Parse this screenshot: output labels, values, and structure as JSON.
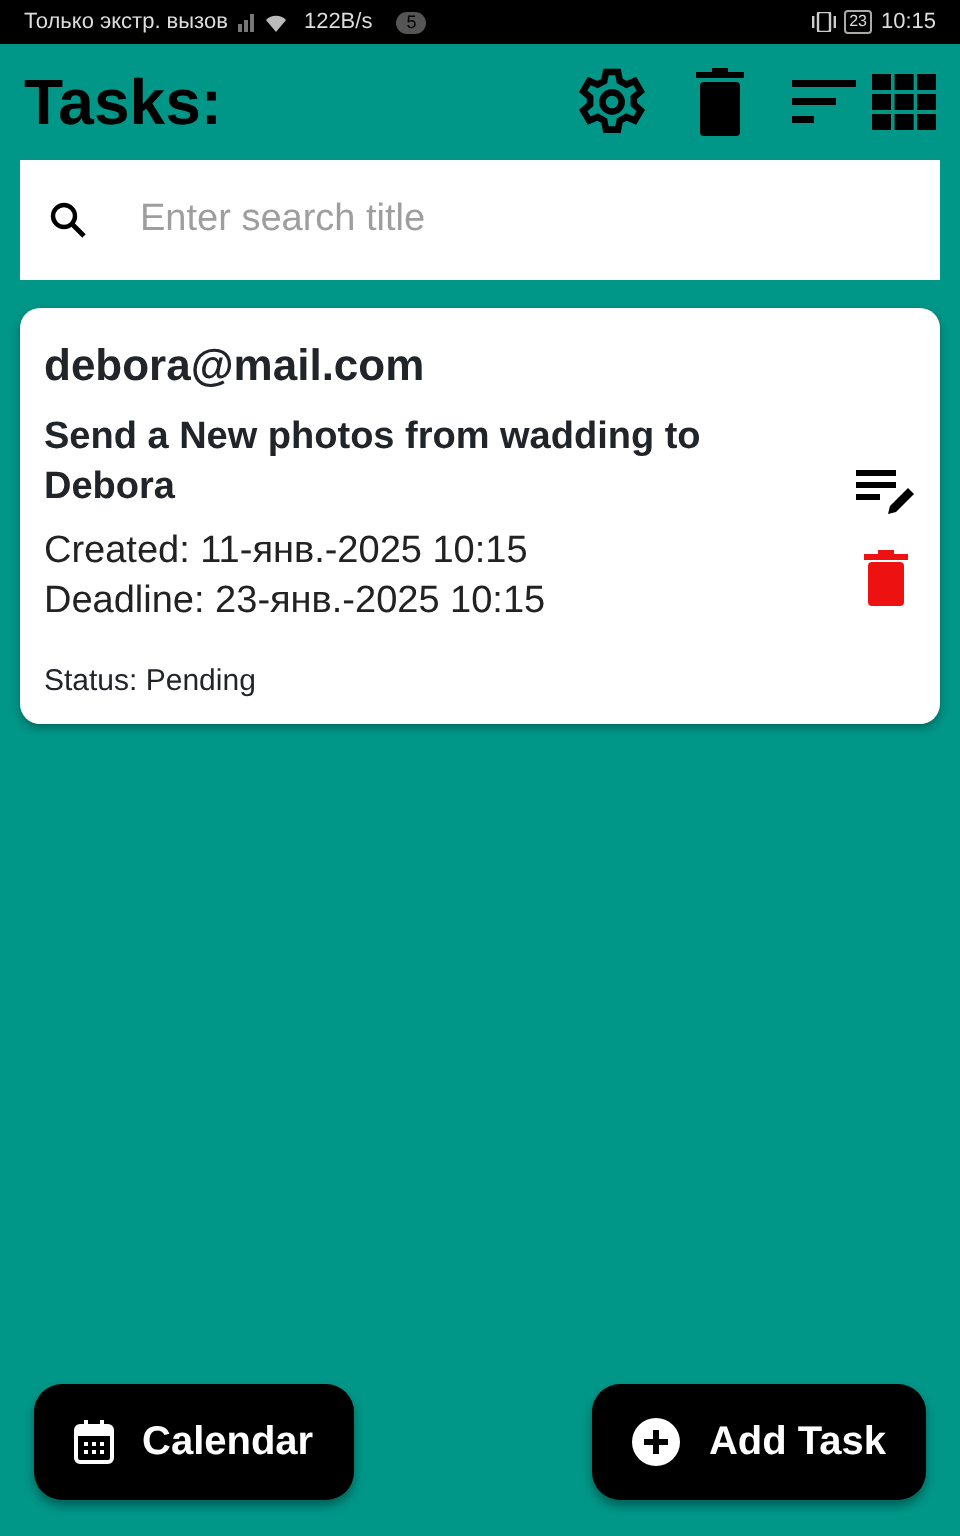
{
  "status_bar": {
    "carrier": "Только экстр. вызов",
    "speed": "122B/s",
    "notification_count": "5",
    "battery": "23",
    "time": "10:15"
  },
  "header": {
    "title": "Tasks:"
  },
  "search": {
    "placeholder": "Enter search title"
  },
  "tasks": [
    {
      "email": "debora@mail.com",
      "title": "Send a New photos from wadding to Debora",
      "created": "Created: 11-янв.-2025 10:15",
      "deadline": "Deadline: 23-янв.-2025 10:15",
      "status": "Status: Pending"
    }
  ],
  "buttons": [
    {
      "kind": "calendar",
      "label": "Calendar"
    },
    {
      "kind": "add",
      "label": "Add Task"
    }
  ]
}
